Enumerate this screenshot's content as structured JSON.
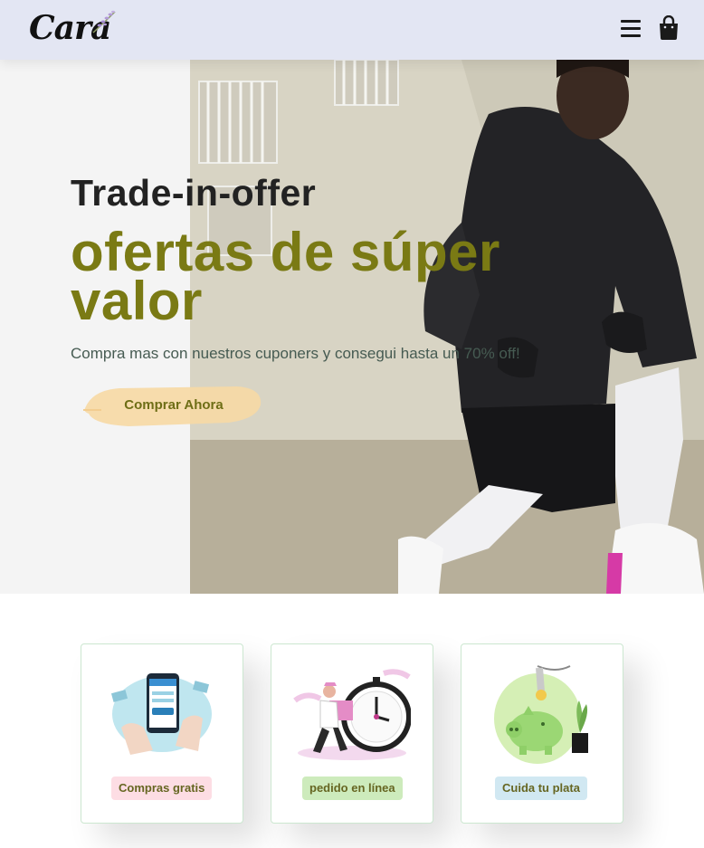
{
  "header": {
    "logo_text": "Cara",
    "icons": [
      "menu-icon",
      "shopping-bag-icon"
    ]
  },
  "hero": {
    "subtitle": "Trade-in-offer",
    "title": "ofertas de súper valor",
    "description": "Compra mas con nuestros cuponers y consegui hasta un 70% off!",
    "button_label": "Comprar Ahora"
  },
  "features": [
    {
      "label": "Compras gratis",
      "badge_color": "#fddde4",
      "icon": "mobile-payment-illustration"
    },
    {
      "label": "pedido en línea",
      "badge_color": "#cdebbc",
      "icon": "delivery-clock-illustration"
    },
    {
      "label": "Cuida tu plata",
      "badge_color": "#d1e8f2",
      "icon": "piggy-bank-illustration"
    }
  ],
  "colors": {
    "header_bg": "#e3e6f3",
    "title_accent": "#7a7a14",
    "button_brush": "#f6d9a5"
  }
}
